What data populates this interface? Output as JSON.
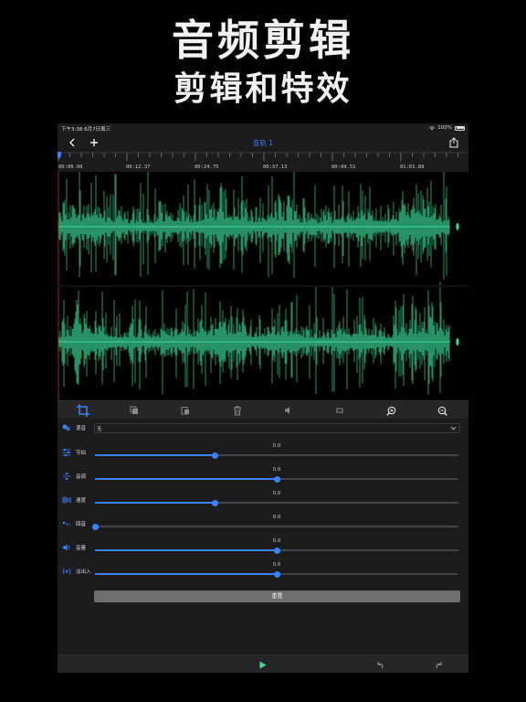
{
  "hero": {
    "title": "音频剪辑",
    "subtitle": "剪辑和特效"
  },
  "status": {
    "time": "下午3:38  6月7日周三",
    "battery": "100%"
  },
  "nav": {
    "title": "音轨 1"
  },
  "ruler": {
    "labels": [
      "00:00.00",
      "00:12.37",
      "00:24.75",
      "00:37.13",
      "00:49.51",
      "01:01.89"
    ]
  },
  "effects": {
    "reverb": {
      "label": "混音",
      "value": "无"
    },
    "rows": [
      {
        "label": "节拍",
        "value_text": "0.0",
        "value": 0.33
      },
      {
        "label": "音调",
        "value_text": "0.0",
        "value": 0.5
      },
      {
        "label": "速度",
        "value_text": "0.0",
        "value": 0.33
      },
      {
        "label": "回音",
        "value_text": "0.0",
        "value": 0.0
      },
      {
        "label": "音量",
        "value_text": "0.0",
        "value": 0.5
      },
      {
        "label": "淡出入",
        "value_text": "0.0",
        "value": 0.5
      }
    ],
    "reset_label": "重置"
  },
  "colors": {
    "accent": "#3b82f6",
    "wave": "#3ddc97",
    "background": "#000000",
    "panel": "#1c1c1e"
  },
  "icons": {
    "toolbar": [
      "crop-icon",
      "copy-icon",
      "paste-icon",
      "trash-icon",
      "mute-icon",
      "loop-icon",
      "zoom-in-icon",
      "zoom-out-icon"
    ],
    "bottom": [
      "play-icon",
      "undo-icon",
      "redo-icon"
    ]
  }
}
